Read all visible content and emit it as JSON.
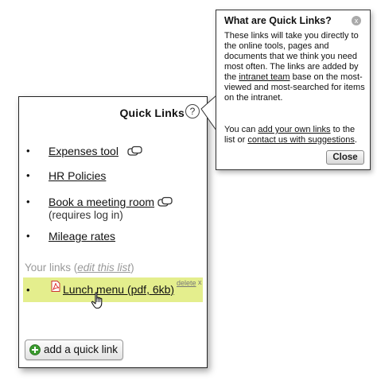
{
  "quick_links": {
    "title": "Quick Links",
    "help_icon": "?",
    "items": [
      {
        "label": "Expenses tool",
        "note": "",
        "popup_icon": "external-window-icon"
      },
      {
        "label": "HR Policies",
        "note": "",
        "popup_icon": ""
      },
      {
        "label": "Book a meeting room",
        "note": "(requires log in)",
        "popup_icon": "external-window-icon"
      },
      {
        "label": "Mileage rates",
        "note": "",
        "popup_icon": ""
      }
    ],
    "your_links_label": "Your links (",
    "edit_list_label": "edit this list",
    "your_links_close": ")",
    "user_links": [
      {
        "label": "Lunch menu (pdf, 6kb)",
        "file_icon": "pdf-icon",
        "delete_label": "delete",
        "delete_x": "x",
        "highlight_color": "#e4ee8d"
      }
    ],
    "add_button_label": "add a quick link",
    "add_icon_color": "#3a9a2e"
  },
  "tooltip": {
    "title": "What are Quick Links?",
    "close_icon": "x",
    "para1_a": "These links will take you directly to the online tools, pages and documents that we think you need most often. The links are added by the ",
    "para1_link": "intranet team",
    "para1_b": " base on the most-viewed and most-searched for items on the intranet.",
    "para2_a": "You can ",
    "para2_link1": "add your own links",
    "para2_b": " to the list or ",
    "para2_link2": "contact us with suggestions",
    "para2_c": ".",
    "close_button_label": "Close"
  }
}
